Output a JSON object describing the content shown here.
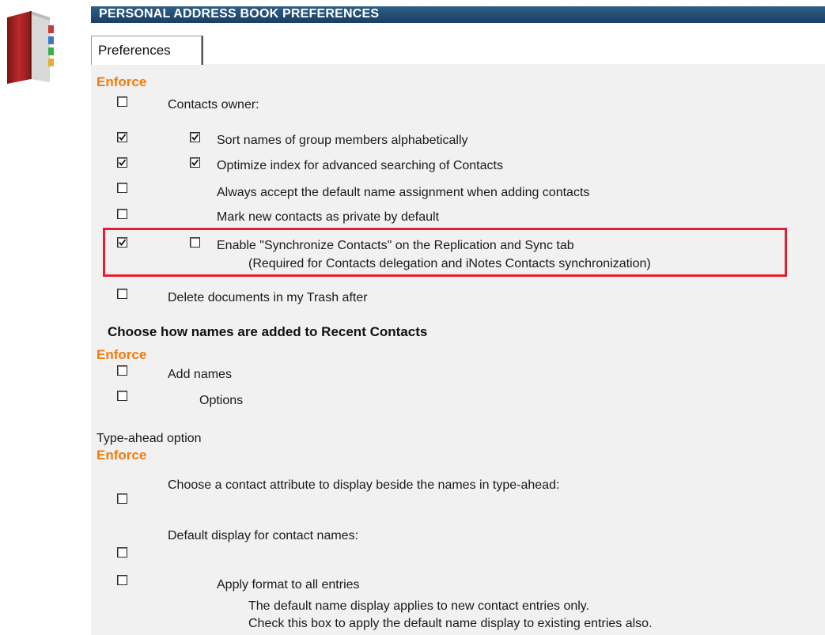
{
  "window": {
    "title": "PERSONAL ADDRESS BOOK PREFERENCES",
    "tab_label": "Preferences"
  },
  "colors": {
    "title_bar": "#1f4a70",
    "enforce": "#f07c10",
    "panel": "#f1f1f1",
    "highlight": "#e0202e"
  },
  "contacts_section": {
    "enforce_label": "Enforce",
    "owner_label": "Contacts owner:",
    "options": [
      {
        "label": "Sort names of group members alphabetically",
        "enforce_checked": true,
        "option_checked": true
      },
      {
        "label": "Optimize index for advanced searching of Contacts",
        "enforce_checked": true,
        "option_checked": true
      },
      {
        "label": "Always accept the default name assignment when adding contacts",
        "enforce_checked": false
      },
      {
        "label": "Mark new contacts as private by default",
        "enforce_checked": false
      },
      {
        "label": "Enable \"Synchronize Contacts\" on the Replication and Sync tab",
        "sub_label": "(Required for Contacts delegation and iNotes Contacts synchronization)",
        "enforce_checked": true,
        "option_checked": false
      }
    ],
    "trash_label": "Delete documents in my Trash after"
  },
  "recent_contacts": {
    "heading": "Choose how names are added to Recent Contacts",
    "enforce_label": "Enforce",
    "add_names_label": "Add names",
    "options_label": "Options"
  },
  "typeahead": {
    "heading": "Type-ahead option",
    "enforce_label": "Enforce",
    "attribute_label": "Choose a contact attribute to display beside the names in type-ahead:",
    "default_display_label": "Default display for contact names:",
    "apply_format_label": "Apply format to all entries",
    "note_line1": "The default name display applies to new contact entries only.",
    "note_line2": "Check this box to apply the default name display to existing entries also."
  }
}
